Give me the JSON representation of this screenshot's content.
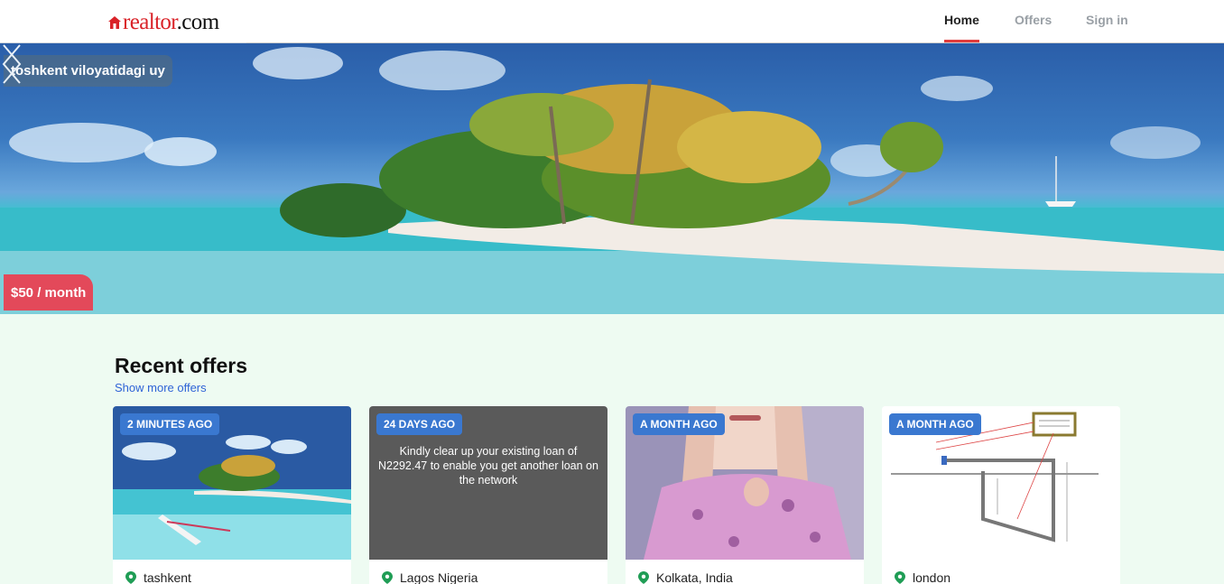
{
  "header": {
    "logo": {
      "main": "realtor",
      "suffix": ".com"
    },
    "nav": [
      {
        "label": "Home",
        "active": true
      },
      {
        "label": "Offers",
        "active": false
      },
      {
        "label": "Sign in",
        "active": false
      }
    ],
    "accent_color": "#e23c3c",
    "brand_color": "#d92228"
  },
  "hero": {
    "title": "toshkent viloyatidagi uy",
    "price": "$50 / month",
    "prev_icon": "chevron-left-icon",
    "next_icon": "chevron-right-icon"
  },
  "recent": {
    "title": "Recent offers",
    "show_more": "Show more offers",
    "cards": [
      {
        "badge": "2 MINUTES AGO",
        "location": "tashkent",
        "image": "tropical-island-photo"
      },
      {
        "badge": "24 DAYS AGO",
        "location": "Lagos Nigeria",
        "image_text": "Kindly clear up your existing loan of N2292.47 to enable you get another loan on the network"
      },
      {
        "badge": "A MONTH AGO",
        "location": "Kolkata, India",
        "image": "person-in-pink-coat-photo"
      },
      {
        "badge": "A MONTH AGO",
        "location": "london",
        "image": "technical-diagram"
      }
    ],
    "badge_color": "#3a78d0",
    "pin_color": "#1f9d55"
  }
}
